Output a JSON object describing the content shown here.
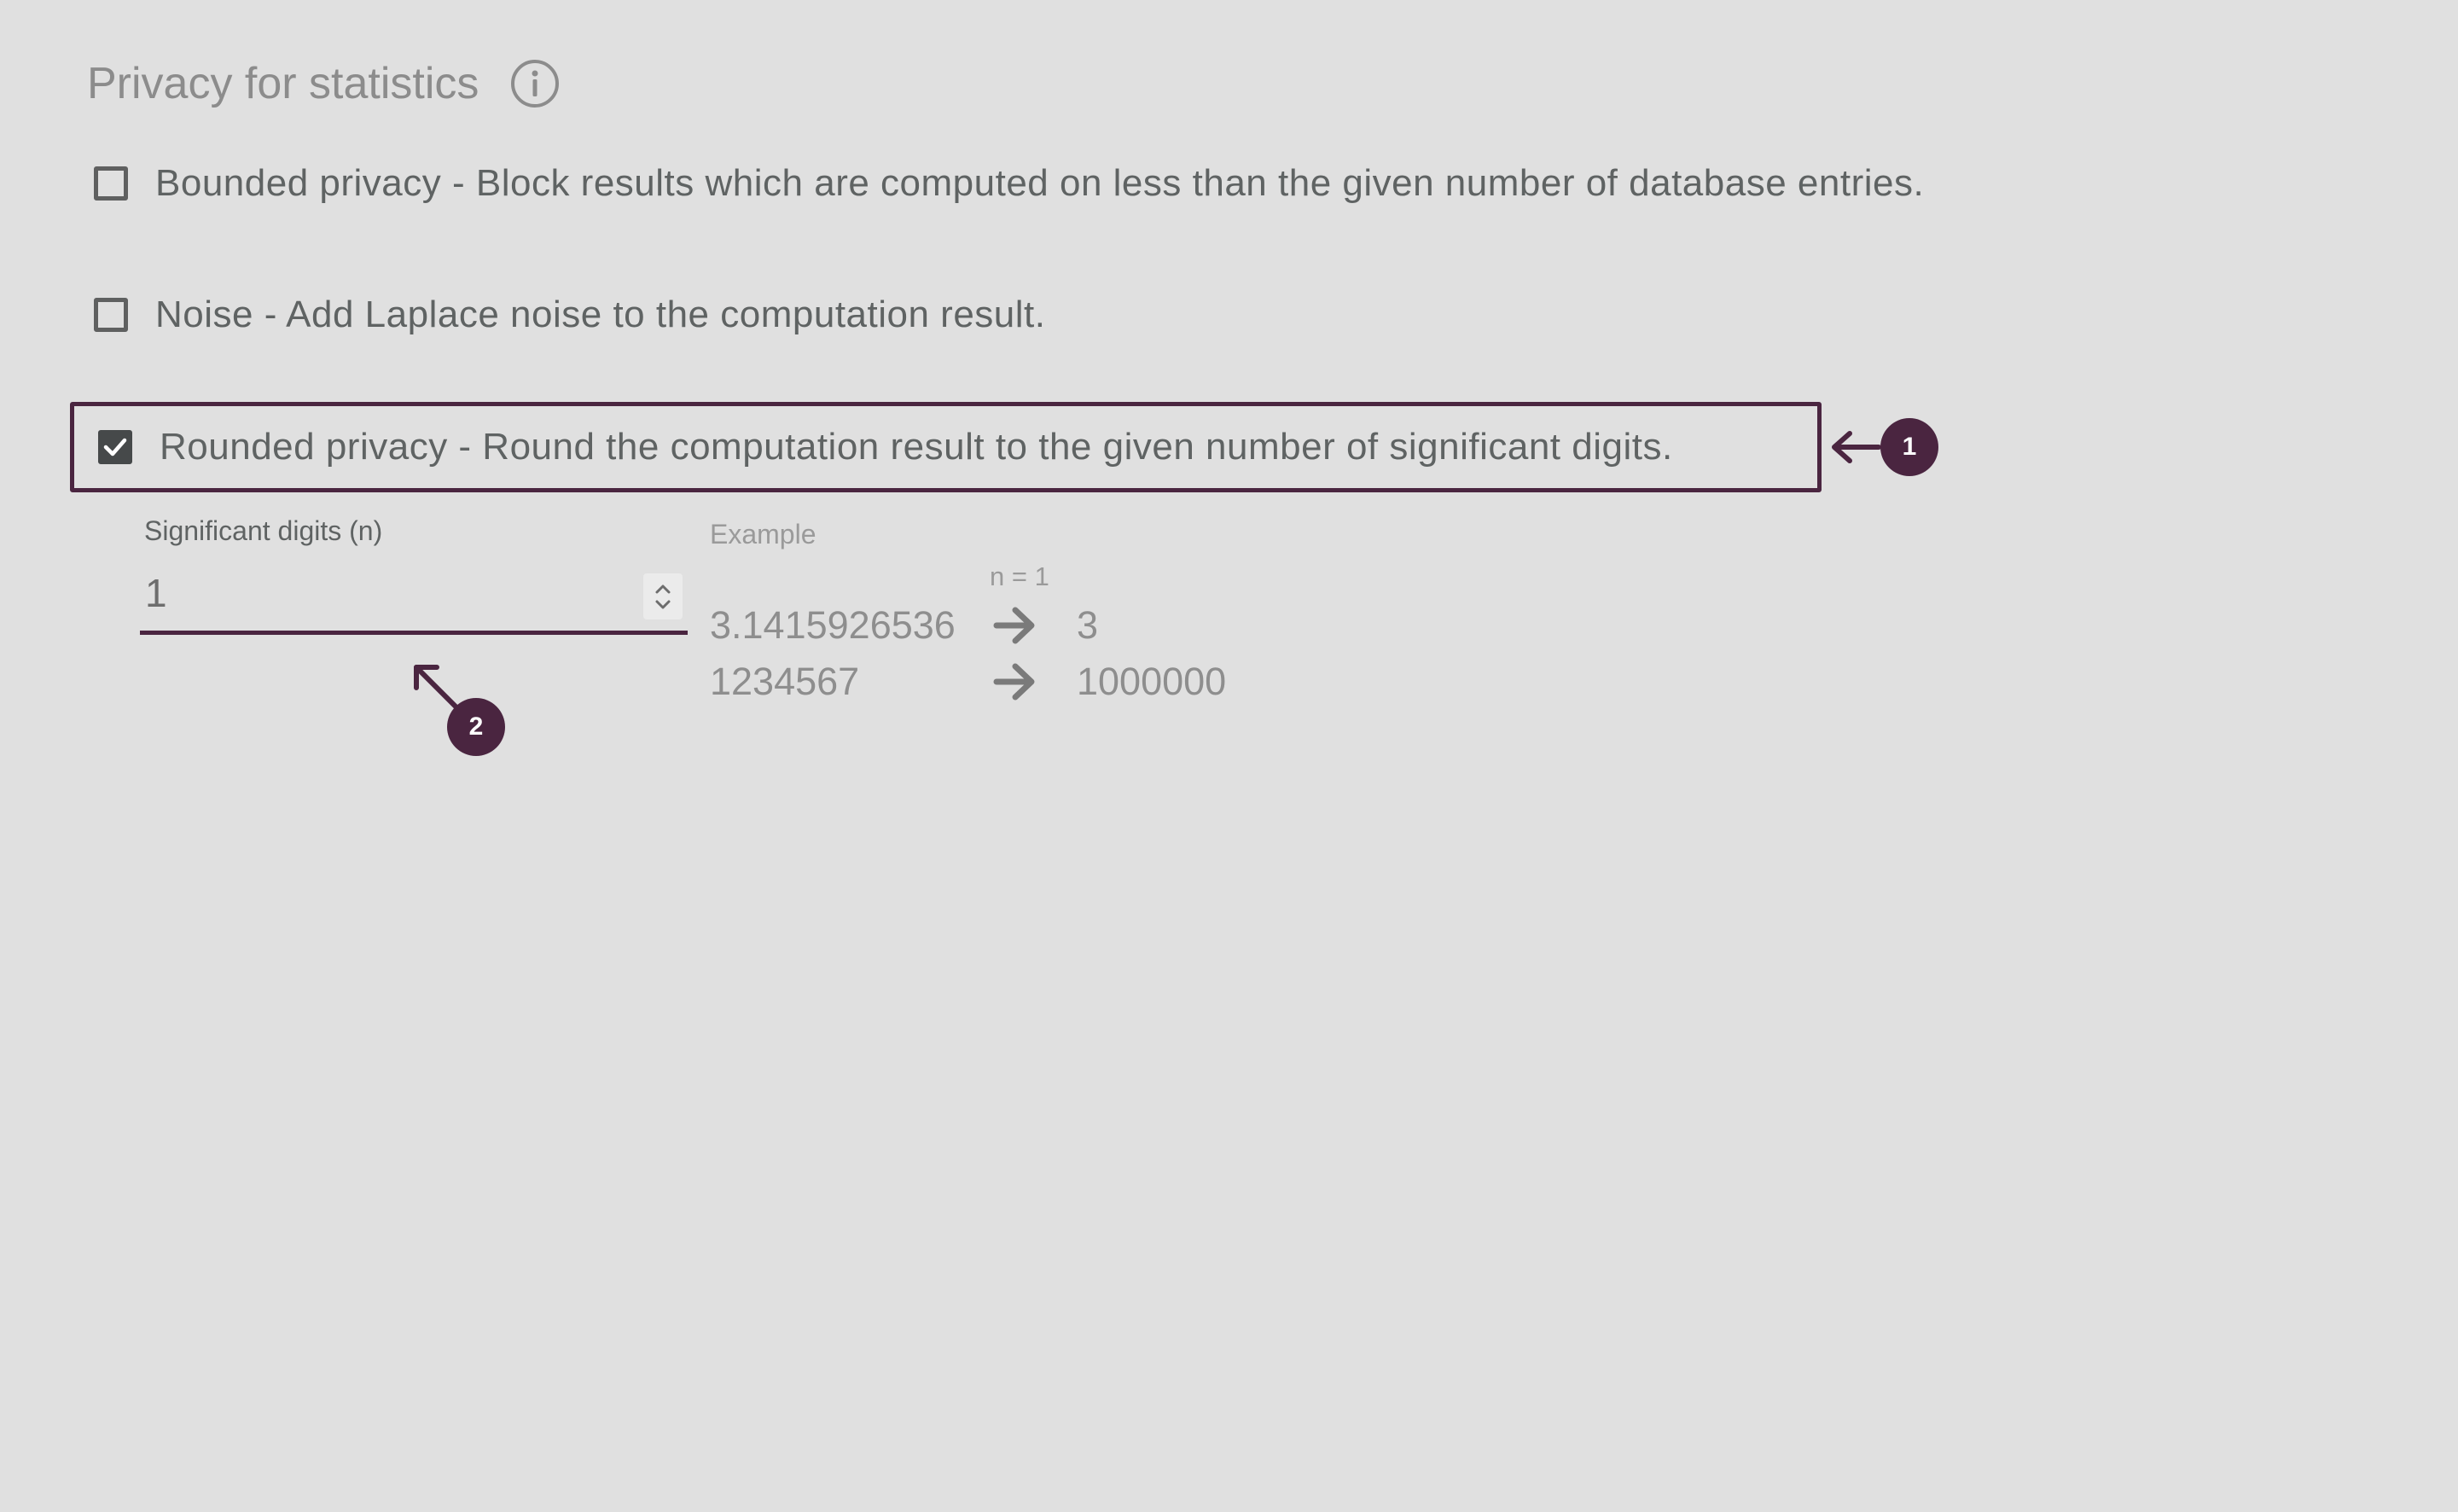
{
  "section": {
    "title": "Privacy for statistics",
    "info_icon": "info-circle-icon"
  },
  "options": [
    {
      "label": "Bounded privacy - Block results which are computed on less than the given number of database entries.",
      "checked": false
    },
    {
      "label": "Noise - Add Laplace noise to the computation result.",
      "checked": false
    },
    {
      "label": "Rounded privacy - Round the computation result to the given number of significant digits.",
      "checked": true
    }
  ],
  "significant_digits": {
    "label": "Significant digits (n)",
    "value": "1"
  },
  "example": {
    "label": "Example",
    "n_label": "n = 1",
    "rows": [
      {
        "input": "3.1415926536",
        "output": "3"
      },
      {
        "input": "1234567",
        "output": "1000000"
      }
    ]
  },
  "callouts": {
    "one": "1",
    "two": "2"
  },
  "colors": {
    "background": "#e0e0e0",
    "accent": "#4a2540",
    "text": "#5f6363",
    "muted": "#8e8e8e"
  }
}
